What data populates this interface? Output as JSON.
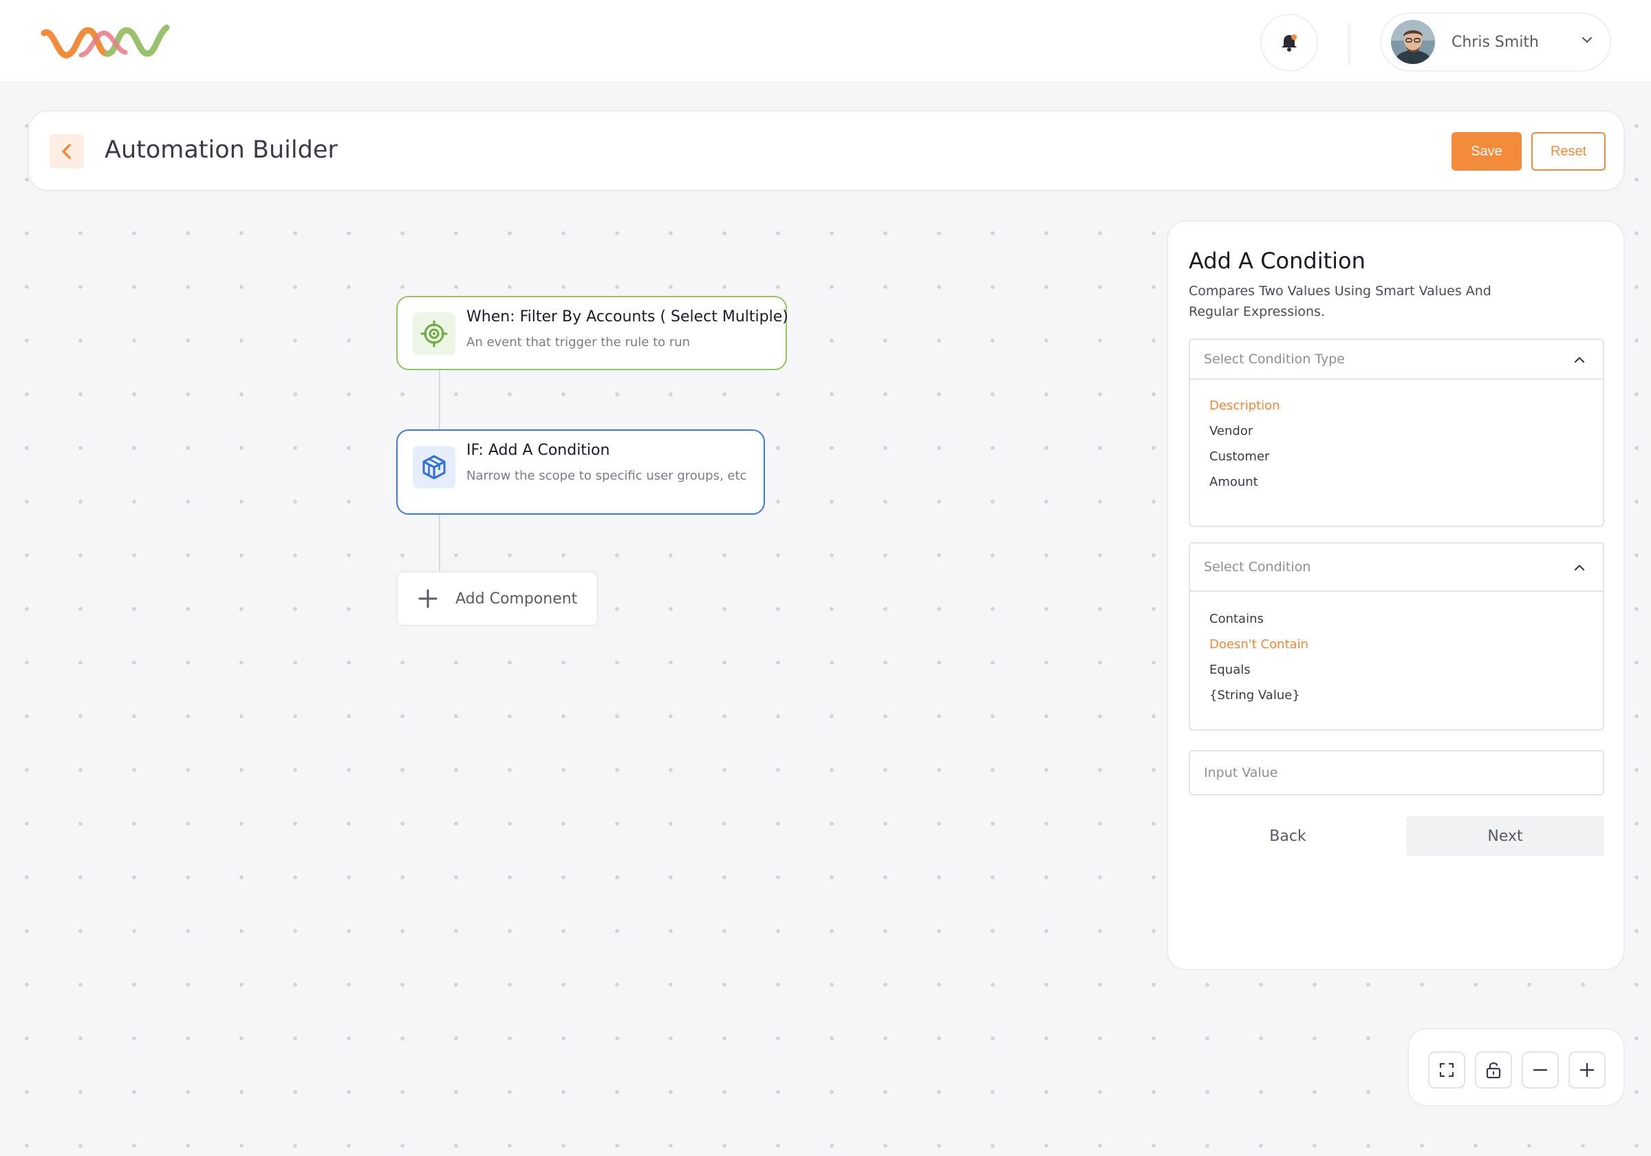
{
  "header": {
    "user_name": "Chris Smith"
  },
  "page": {
    "title": "Automation Builder",
    "save_label": "Save",
    "reset_label": "Reset"
  },
  "flow": {
    "trigger": {
      "title": "When: Filter By Accounts ( Select Multiple)",
      "description": "An event that trigger the rule to run"
    },
    "condition": {
      "title": "IF: Add A Condition",
      "description": "Narrow the scope to specific user groups, etc"
    },
    "add_component_label": "Add Component"
  },
  "panel": {
    "title": "Add A Condition",
    "subtitle": "Compares Two Values Using Smart Values And Regular Expressions.",
    "condition_type": {
      "placeholder": "Select Condition Type",
      "options": [
        "Description",
        "Vendor",
        "Customer",
        "Amount"
      ],
      "active": "Description"
    },
    "condition": {
      "placeholder": "Select Condition",
      "options": [
        "Contains",
        "Doesn't Contain",
        "Equals",
        "{String Value}"
      ],
      "active": "Doesn't Contain"
    },
    "input_placeholder": "Input Value",
    "back_label": "Back",
    "next_label": "Next"
  },
  "colors": {
    "accent": "#f28b3a",
    "trigger_border": "#8fc75a",
    "condition_border": "#3a7ae6"
  },
  "icons": {
    "trigger": "target-icon",
    "condition": "cube-icon",
    "notification": "bell-icon"
  }
}
